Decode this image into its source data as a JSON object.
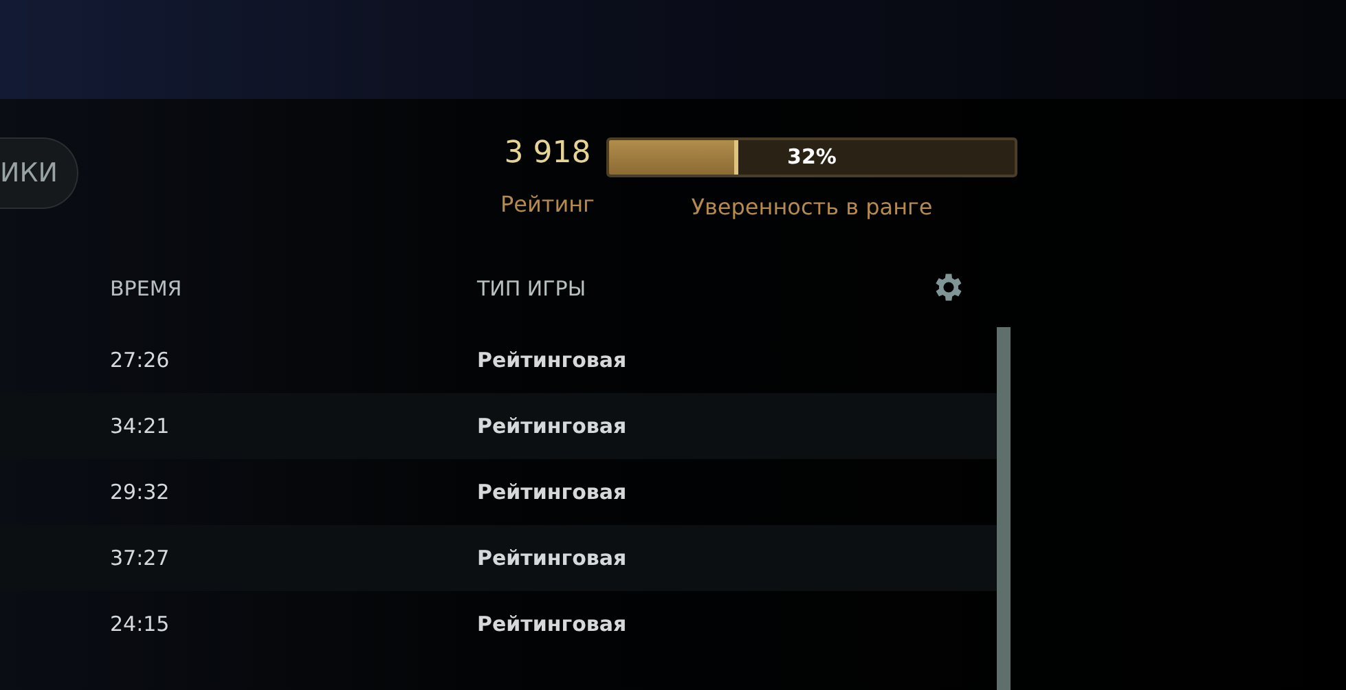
{
  "button": {
    "label": "ИКИ"
  },
  "rating": {
    "value": "3 918",
    "label": "Рейтинг"
  },
  "confidence": {
    "reading": "32%",
    "level": 0.32,
    "label": "Уверенность в ранге"
  },
  "table": {
    "columns": [
      "ВРЕМЯ",
      "ТИП ИГРЫ"
    ],
    "rows": [
      {
        "time": "27:26",
        "type": "Рейтинговая"
      },
      {
        "time": "34:21",
        "type": "Рейтинговая"
      },
      {
        "time": "29:32",
        "type": "Рейтинговая"
      },
      {
        "time": "37:27",
        "type": "Рейтинговая"
      },
      {
        "time": "24:15",
        "type": "Рейтинговая"
      }
    ]
  }
}
